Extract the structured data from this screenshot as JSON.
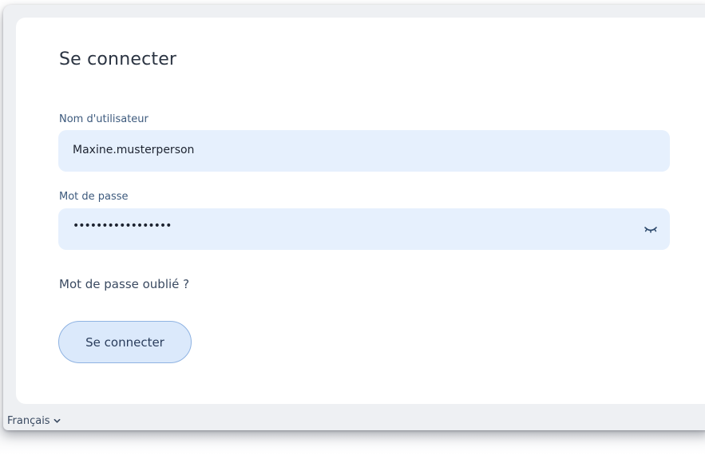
{
  "login": {
    "title": "Se connecter",
    "username_label": "Nom d'utilisateur",
    "username_value": "Maxine.musterperson",
    "password_label": "Mot de passe",
    "password_value_masked": "•••••••••••••••••",
    "password_toggle_icon": "eye-closed-icon",
    "forgot_password_link": "Mot de passe oublié ?",
    "submit_label": "Se connecter"
  },
  "footer": {
    "language": "Français",
    "language_icon": "chevron-down-icon"
  },
  "colors": {
    "field_background": "#e6f0fd",
    "button_background": "#dbe9fb",
    "button_border": "#8fb3e2",
    "label_text": "#3d5a7d"
  }
}
